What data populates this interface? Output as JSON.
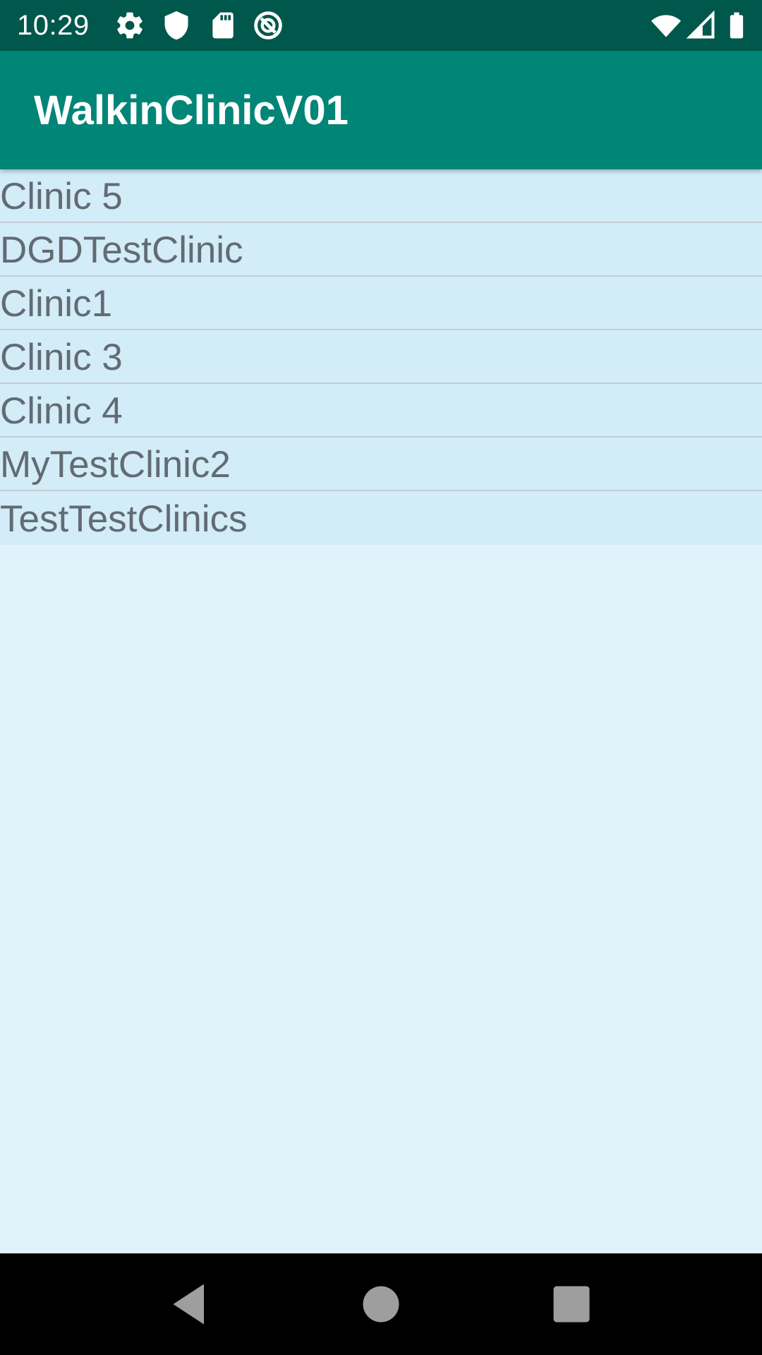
{
  "status_bar": {
    "time": "10:29",
    "left_icons": [
      "gear-icon",
      "shield-icon",
      "sd-card-icon",
      "no-sync-icon"
    ],
    "right_icons": [
      "wifi-icon",
      "signal-icon",
      "battery-icon"
    ]
  },
  "app_bar": {
    "title": "WalkinClinicV01"
  },
  "clinics": [
    "Clinic 5",
    "DGDTestClinic",
    "Clinic1",
    "Clinic 3",
    "Clinic 4",
    "MyTestClinic2",
    "TestTestClinics"
  ],
  "nav_bar": {
    "buttons": [
      "back-icon",
      "home-icon",
      "recents-icon"
    ]
  },
  "colors": {
    "status_bar": "#00574B",
    "app_bar": "#008577",
    "list_item_bg": "#D2ECF8",
    "screen_bg": "#E1F2FA",
    "list_text": "#636B72"
  }
}
